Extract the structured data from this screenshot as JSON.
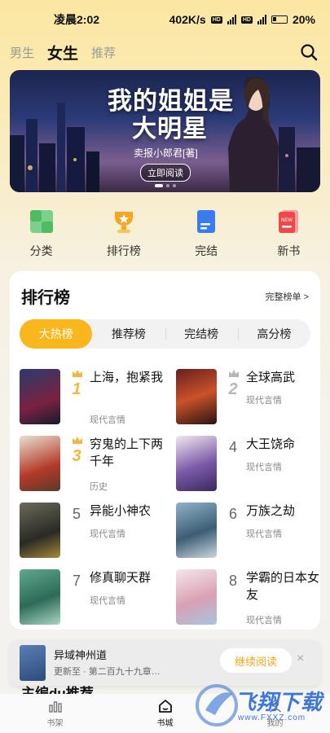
{
  "status_bar": {
    "time": "凌晨2:02",
    "speed": "402K/s",
    "battery": "20%"
  },
  "top_nav": {
    "tabs": [
      {
        "label": "男生"
      },
      {
        "label": "女生"
      },
      {
        "label": "推荐"
      }
    ]
  },
  "banner": {
    "title_line1": "我的姐姐是",
    "title_line2": "大明星",
    "author": "卖报小郎君[著]",
    "cta": "立即阅读"
  },
  "quick_links": [
    {
      "label": "分类",
      "icon": "category-icon",
      "color": "#5cc16f"
    },
    {
      "label": "排行榜",
      "icon": "trophy-icon",
      "color": "#f5a623"
    },
    {
      "label": "完结",
      "icon": "book-icon",
      "color": "#3a7bf0"
    },
    {
      "label": "新书",
      "icon": "new-book-icon",
      "color": "#f0474a"
    }
  ],
  "ranking": {
    "title": "排行榜",
    "more": "完整榜单 >",
    "tabs": [
      "大热榜",
      "推荐榜",
      "完结榜",
      "高分榜"
    ],
    "books": [
      {
        "rank": "1",
        "name": "上海，抱紧我",
        "category": "现代言情"
      },
      {
        "rank": "2",
        "name": "全球高武",
        "category": "现代言情"
      },
      {
        "rank": "3",
        "name": "穷鬼的上下两千年",
        "category": "历史"
      },
      {
        "rank": "4",
        "name": "大王饶命",
        "category": "现代言情"
      },
      {
        "rank": "5",
        "name": "异能小神农",
        "category": "现代言情"
      },
      {
        "rank": "6",
        "name": "万族之劫",
        "category": "现代言情"
      },
      {
        "rank": "7",
        "name": "修真聊天群",
        "category": "现代言情"
      },
      {
        "rank": "8",
        "name": "学霸的日本女友",
        "category": "现代言情"
      }
    ]
  },
  "continue_reading": {
    "title": "异域神州道",
    "progress": "更新至 · 第二百九十九章…",
    "button": "继续阅读",
    "close": "×"
  },
  "peek_section": {
    "title": "主编du推荐"
  },
  "bottom_tabs": [
    {
      "label": "书架"
    },
    {
      "label": "书城"
    },
    {
      "label": "我的"
    }
  ],
  "watermark": {
    "text": "飞翔下载",
    "url": "www.FXXZ.com"
  },
  "colors": {
    "accent": "#f9b71d",
    "background": "#fbe7a3"
  }
}
